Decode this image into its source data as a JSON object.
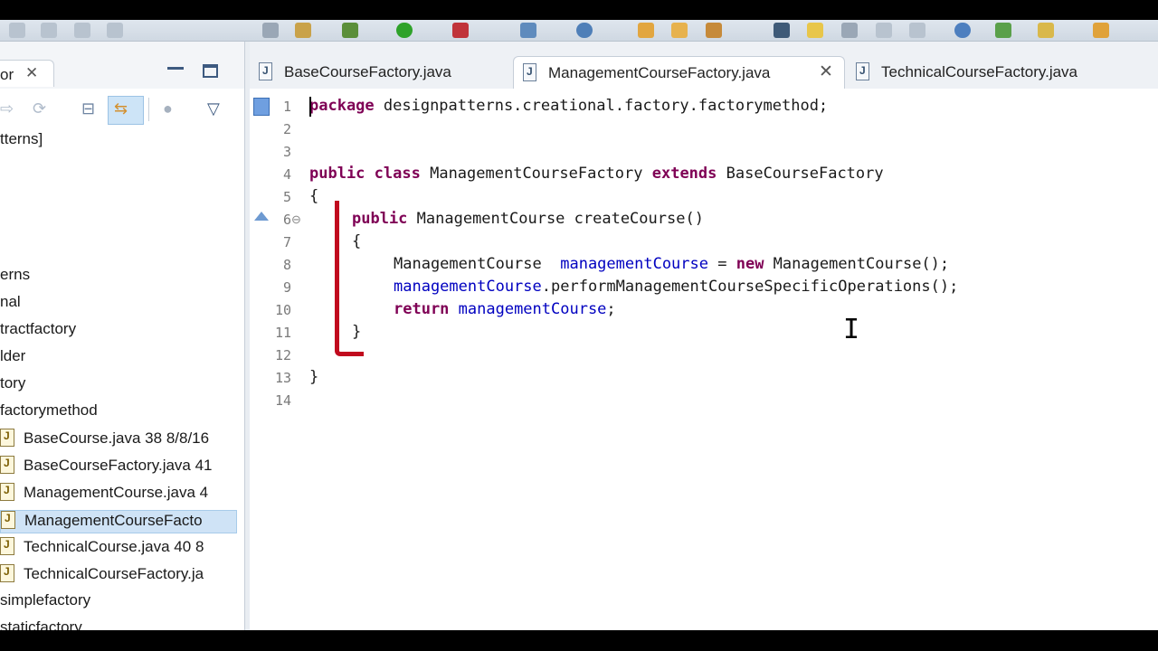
{
  "left_panel": {
    "tab_label": "or",
    "tree_items": [
      {
        "label": "tterns]"
      },
      {
        "label": "erns"
      },
      {
        "label": "nal"
      },
      {
        "label": "tractfactory"
      },
      {
        "label": "lder"
      },
      {
        "label": "tory"
      },
      {
        "label": "factorymethod"
      },
      {
        "label": "BaseCourse.java 38  8/8/16"
      },
      {
        "label": "BaseCourseFactory.java 41"
      },
      {
        "label": "ManagementCourse.java 4"
      },
      {
        "label": "ManagementCourseFacto"
      },
      {
        "label": "TechnicalCourse.java 40  8"
      },
      {
        "label": "TechnicalCourseFactory.ja"
      },
      {
        "label": "simplefactory"
      },
      {
        "label": "staticfactory"
      }
    ]
  },
  "editor_tabs": [
    {
      "label": "BaseCourseFactory.java"
    },
    {
      "label": "ManagementCourseFactory.java"
    },
    {
      "label": "TechnicalCourseFactory.java"
    }
  ],
  "code": {
    "line_numbers": [
      "1",
      "2",
      "3",
      "4",
      "5",
      "6",
      "7",
      "8",
      "9",
      "10",
      "11",
      "12",
      "13",
      "14"
    ],
    "l1": {
      "kw": "package",
      "rest": " designpatterns.creational.factory.factorymethod;"
    },
    "l4": {
      "kw1": "public",
      "kw2": "class",
      "name": " ManagementCourseFactory ",
      "kw3": "extends",
      "base": " BaseCourseFactory"
    },
    "l5": "{",
    "l6": {
      "kw": "public",
      "rest": " ManagementCourse createCourse()"
    },
    "l7": "{",
    "l8": {
      "type": "ManagementCourse  ",
      "var": "managementCourse",
      "eq": " = ",
      "kw": "new",
      "rest": " ManagementCourse();"
    },
    "l9": {
      "var": "managementCourse",
      "rest": ".performManagementCourseSpecificOperations();"
    },
    "l10": {
      "kw": "return",
      "var": " managementCourse",
      "end": ";"
    },
    "l11": "}",
    "l13": "}"
  },
  "colors": {
    "keyword": "#7f0055",
    "field": "#0000c0",
    "annotation_red": "#c10a1e"
  }
}
